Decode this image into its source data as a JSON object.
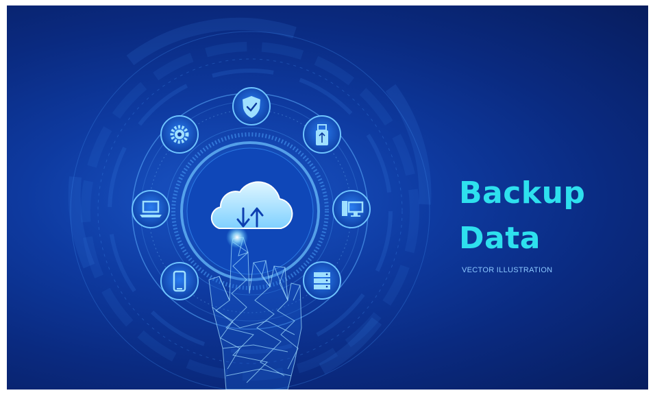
{
  "headline": {
    "line1": "Backup",
    "line2": "Data"
  },
  "subtitle": "VECTOR ILLUSTRATION",
  "center_icon": "cloud-sync-icon",
  "orbit_icons": [
    "shield-check-icon",
    "usb-drive-icon",
    "desktop-computer-icon",
    "server-icon",
    "smartphone-icon",
    "laptop-icon",
    "gear-icon"
  ],
  "colors": {
    "background_dark": "#071d5e",
    "background_light": "#1a56c8",
    "accent_cyan": "#2ee0ee",
    "icon_glow": "#4fc3ff",
    "hand_wire": "#9fdcff"
  }
}
